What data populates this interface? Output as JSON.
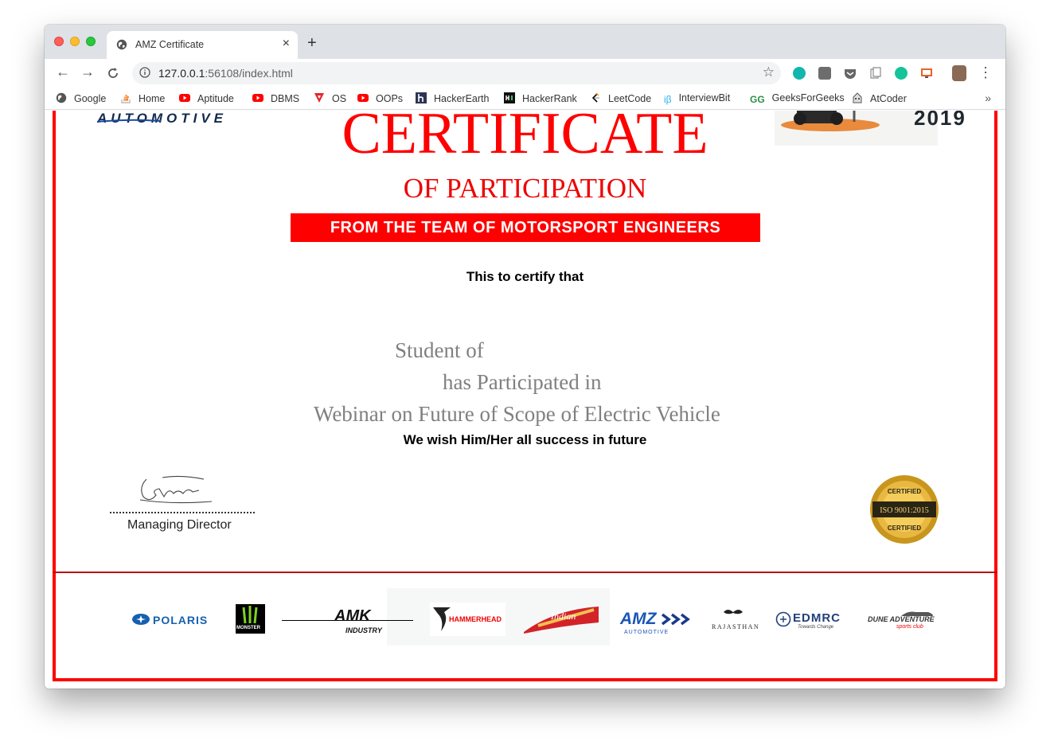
{
  "browser": {
    "tab_title": "AMZ Certificate",
    "new_tab": "+",
    "close": "×",
    "url_host": "127.0.0.1",
    "url_rest": ":56108/index.html",
    "star": "☆",
    "more": "⋮"
  },
  "bookmarks": {
    "items": [
      {
        "label": "Google"
      },
      {
        "label": "Home"
      },
      {
        "label": "Aptitude"
      },
      {
        "label": "DBMS"
      },
      {
        "label": "OS"
      },
      {
        "label": "OOPs"
      },
      {
        "label": "HackerEarth"
      },
      {
        "label": "HackerRank"
      },
      {
        "label": "LeetCode"
      },
      {
        "label": "InterviewBit"
      },
      {
        "label": "GeeksForGeeks"
      },
      {
        "label": "AtCoder"
      }
    ],
    "more": "»"
  },
  "certificate": {
    "logo_left": "AUTOMOTIVE",
    "logo_right": "2019",
    "title": "CERTIFICATE",
    "subtitle": "OF PARTICIPATION",
    "banner": "FROM THE TEAM OF MOTORSPORT ENGINEERS",
    "certify": "This to certify that",
    "line1": "Student of",
    "line2": "has Participated in",
    "line3": "Webinar on Future of Scope of Electric Vehicle",
    "wish": "We wish Him/Her all success in future",
    "signature_caption": "Managing Director",
    "seal_top": "CERTIFIED",
    "seal_mid": "ISO 9001:2015",
    "seal_bottom": "CERTIFIED"
  },
  "sponsors": {
    "polaris": "POLARIS",
    "monster": "MONSTER",
    "amk": "AMK",
    "amk_sub": "INDUSTRY",
    "hammerhead": "HAMMERHEAD",
    "indian": "Indian",
    "amz": "AMZ",
    "amz_sub": "AUTOMOTIVE",
    "rajasthan": "RAJASTHAN",
    "edmrc": "EDMRC",
    "edmrc_sub": "Towards Change",
    "dune": "DUNE ADVENTURE",
    "dune_sub": "sports club"
  }
}
